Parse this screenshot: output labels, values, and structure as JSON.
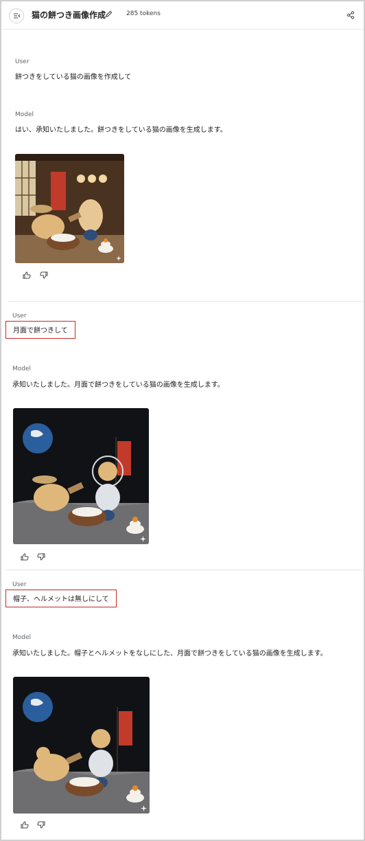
{
  "header": {
    "title": "猫の餅つき画像作成",
    "tokens": "285 tokens"
  },
  "turns": [
    {
      "role": "User",
      "text": "餅つきをしている猫の画像を作成して"
    },
    {
      "role": "Model",
      "text": "はい、承知いたしました。餅つきをしている猫の画像を生成します。",
      "image": "cats-mochi-japanese-room"
    },
    {
      "role": "User",
      "text": "月面で餅つきして"
    },
    {
      "role": "Model",
      "text": "承知いたしました。月面で餅つきをしている猫の画像を生成します。",
      "image": "cats-mochi-moon-helmets"
    },
    {
      "role": "User",
      "text": "帽子、ヘルメットは無しにして"
    },
    {
      "role": "Model",
      "text": "承知いたしました。帽子とヘルメットをなしにした、月面で餅つきをしている猫の画像を生成します。",
      "image": "cats-mochi-moon-no-helmets"
    }
  ],
  "icons": {
    "menu": "menu-collapse-icon",
    "edit": "pencil-icon",
    "share": "share-icon",
    "like": "thumbs-up-icon",
    "dislike": "thumbs-down-icon",
    "sparkle": "sparkle-icon"
  },
  "colors": {
    "highlight_box": "#c62828",
    "divider": "#e3e3e3"
  }
}
